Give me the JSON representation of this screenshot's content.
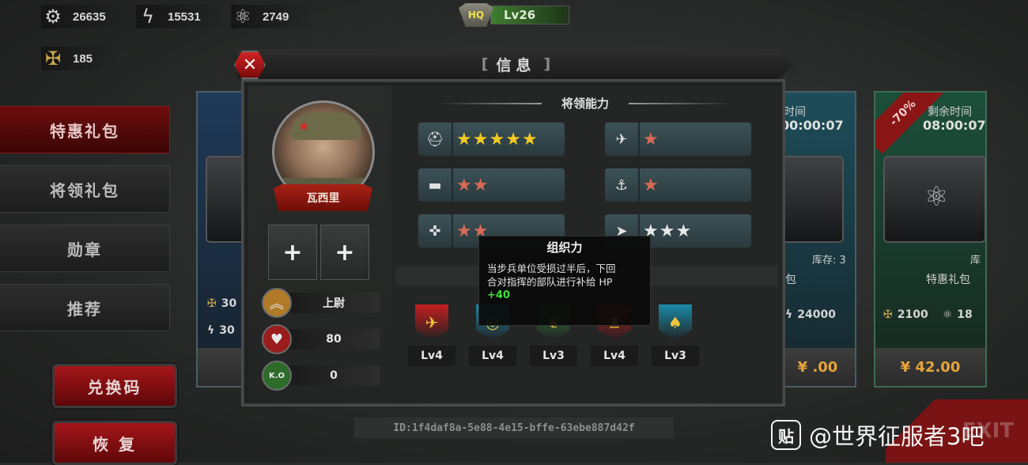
{
  "resources": [
    {
      "icon": "gear-icon",
      "glyph": "⚙",
      "value": "26635"
    },
    {
      "icon": "lightning-icon",
      "glyph": "ϟ",
      "value": "15531"
    },
    {
      "icon": "atom-icon",
      "glyph": "⚛",
      "value": "2749"
    },
    {
      "icon": "medal-icon",
      "glyph": "✠",
      "value": "185"
    }
  ],
  "hq": {
    "badge": "HQ",
    "level": "Lv26"
  },
  "sidebar": {
    "items": [
      {
        "label": "特惠礼包",
        "active": true
      },
      {
        "label": "将领礼包",
        "active": false
      },
      {
        "label": "勋章",
        "active": false
      },
      {
        "label": "推荐",
        "active": false
      }
    ],
    "redeem_label": "兑换码",
    "restore_label": "恢 复"
  },
  "cards": {
    "left": {
      "row1": "30",
      "row2": "30"
    },
    "mid": {
      "time_label": "时间",
      "time": "00:00:07",
      "stock": "库存: 3",
      "name": "包",
      "row2": "24000",
      "price": "¥ .00"
    },
    "right": {
      "discount": "-70%",
      "time_label": "剩余时间",
      "time": "08:00:07",
      "stock": "库",
      "name": "特惠礼包",
      "row1a": "2100",
      "row1b": "18",
      "price": "¥ 42.00"
    }
  },
  "modal": {
    "title": "信息",
    "bracket_left": "[",
    "bracket_right": "]",
    "close_glyph": "✕",
    "general": {
      "name": "瓦西里",
      "slots": [
        "+",
        "+"
      ],
      "stats": [
        {
          "icon": "rank-chevron-icon",
          "glyph": "︽",
          "value": "上尉",
          "color": "#b07a28"
        },
        {
          "icon": "heart-icon",
          "glyph": "♥",
          "value": "80",
          "color": "#9a1c1c"
        },
        {
          "icon": "helmet-ko-icon",
          "glyph": "K.O",
          "value": "0",
          "color": "#2d6b2a"
        }
      ]
    },
    "abilities_title": "将领能力",
    "abilities": [
      {
        "icon": "infantry-icon",
        "glyph": "⛑",
        "stars": 5,
        "kind": "gold"
      },
      {
        "icon": "aircraft-icon",
        "glyph": "✈",
        "stars": 1,
        "kind": "red"
      },
      {
        "icon": "tank-icon",
        "glyph": "▬",
        "stars": 2,
        "kind": "red"
      },
      {
        "icon": "anchor-icon",
        "glyph": "⚓",
        "stars": 1,
        "kind": "red"
      },
      {
        "icon": "artillery-icon",
        "glyph": "✜",
        "stars": 2,
        "kind": "red"
      },
      {
        "icon": "command-icon",
        "glyph": "➤",
        "stars": 3,
        "kind": "white"
      }
    ],
    "tooltip": {
      "title": "组织力",
      "line1": "当步兵单位受损过半后，下回",
      "line2": "合对指挥的部队进行补给 HP",
      "bonus": "+40"
    },
    "medals": [
      {
        "level": "Lv4",
        "color": "#c41e1e",
        "glyph": "✈"
      },
      {
        "level": "Lv4",
        "color": "#1a8aa8",
        "glyph": "◎"
      },
      {
        "level": "Lv3",
        "color": "#2d7a3a",
        "glyph": "❦"
      },
      {
        "level": "Lv4",
        "color": "#b81a1a",
        "glyph": "♜"
      },
      {
        "level": "Lv3",
        "color": "#1a8aa8",
        "glyph": "♠"
      }
    ]
  },
  "id_text": "ID:1f4daf8a-5e88-4e15-bffe-63ebe887d42f",
  "exit_label": "EXIT",
  "watermark": {
    "logo": "贴",
    "text": "@世界征服者3吧"
  }
}
